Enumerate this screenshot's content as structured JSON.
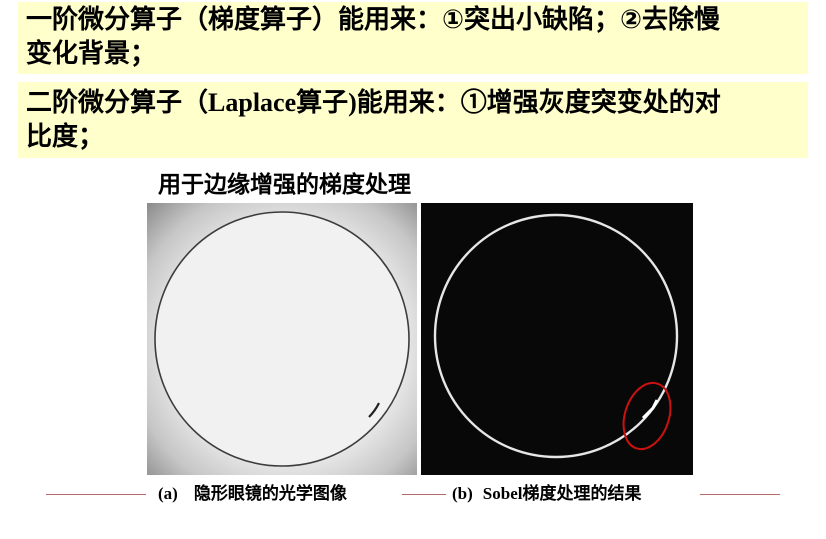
{
  "statements": {
    "first_order": {
      "line1": "一阶微分算子（梯度算子）能用来：①突出小缺陷；②去除慢",
      "line2": "变化背景；"
    },
    "second_order": {
      "prefix": "二阶微分算子（",
      "operator_name": "Laplace",
      "mid": "算子",
      "after": ")能用来：①增强灰度突变处的对",
      "line2": "比度；"
    }
  },
  "figure": {
    "title": "用于边缘增强的梯度处理",
    "panel_a": {
      "tag": "(a)",
      "caption": "隐形眼镜的光学图像"
    },
    "panel_b": {
      "tag": "(b)",
      "caption_prefix": "Sobel",
      "caption": "梯度处理的结果"
    }
  },
  "colors": {
    "band_background": "#ffffcc",
    "highlight_circle": "#cc1111",
    "caption_rule": "#b36b6b"
  }
}
